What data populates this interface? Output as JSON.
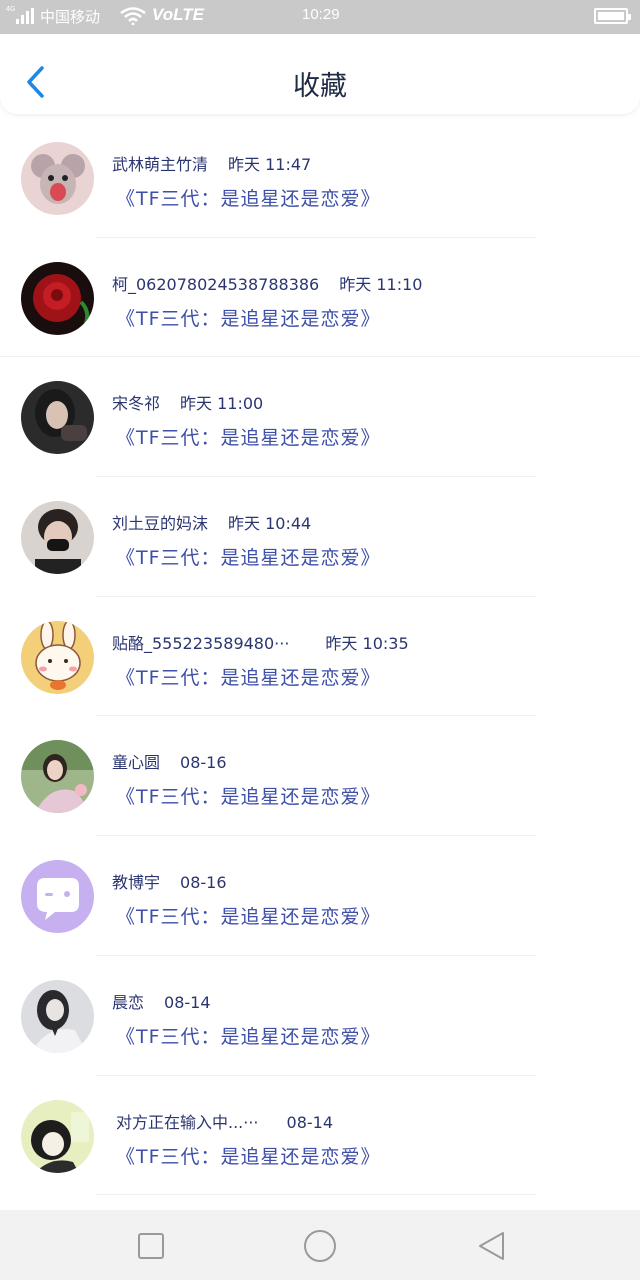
{
  "status_bar": {
    "network": "4G",
    "carrier": "中国移动",
    "volte": "VoLTE",
    "time": "10:29",
    "battery_level": 1.0
  },
  "header": {
    "title": "收藏",
    "back_icon": "chevron-left-icon"
  },
  "colors": {
    "accent": "#1e88e5",
    "title_text": "#1f2a44",
    "item_text": "#3d4fa8"
  },
  "favorites": [
    {
      "name": "武林萌主竹清",
      "time": "昨天 11:47",
      "title": "《TF三代：是追星还是恋爱》",
      "avatar": "cartoon-mouse-avatar"
    },
    {
      "name": "柯_062078024538788386",
      "time": "昨天 11:10",
      "title": "《TF三代：是追星还是恋爱》",
      "avatar": "red-rose-avatar"
    },
    {
      "name": "宋冬祁",
      "time": "昨天 11:00",
      "title": "《TF三代：是追星还是恋爱》",
      "avatar": "girl-photo-avatar"
    },
    {
      "name": "刘土豆的妈沫",
      "time": "昨天 10:44",
      "title": "《TF三代：是追星还是恋爱》",
      "avatar": "masked-boy-avatar"
    },
    {
      "name": "贴酪_555223589480···",
      "time": "昨天 10:35",
      "title": "《TF三代：是追星还是恋爱》",
      "avatar": "bunny-cartoon-avatar"
    },
    {
      "name": "童心圆",
      "time": "08-16",
      "title": "《TF三代：是追星还是恋爱》",
      "avatar": "girl-garden-avatar"
    },
    {
      "name": "教博宇",
      "time": "08-16",
      "title": "《TF三代：是追星还是恋爱》",
      "avatar": "chat-bubble-avatar"
    },
    {
      "name": "晨恋",
      "time": "08-14",
      "title": "《TF三代：是追星还是恋爱》",
      "avatar": "girl-bw-avatar"
    },
    {
      "name": "对方正在输入中...···",
      "time": "08-14",
      "title": "《TF三代：是追星还是恋爱》",
      "avatar": "manga-girl-avatar"
    }
  ],
  "nav_bar": {
    "recents_icon": "square-icon",
    "home_icon": "circle-icon",
    "back_icon": "triangle-back-icon"
  }
}
